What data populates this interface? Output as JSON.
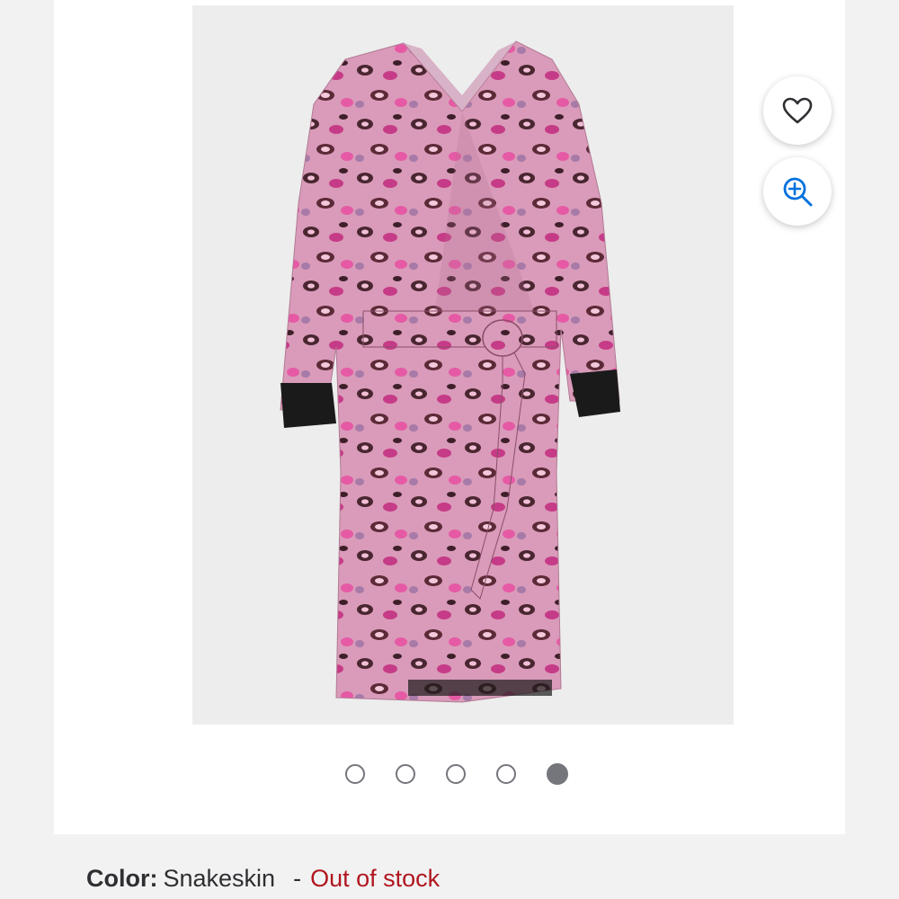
{
  "product": {
    "image_alt": "Pink leopard print satin robe with black cuffs"
  },
  "gallery": {
    "dot_count": 5,
    "active_index": 4
  },
  "actions": {
    "favorite_icon": "heart-icon",
    "zoom_icon": "zoom-in-icon"
  },
  "variant": {
    "color_label": "Color:",
    "color_value": "Snakeskin",
    "separator": "-",
    "stock_status": "Out of stock"
  },
  "colors": {
    "stock_red": "#b0161f",
    "accent_blue": "#0071dc",
    "dot_gray": "#74767c"
  }
}
